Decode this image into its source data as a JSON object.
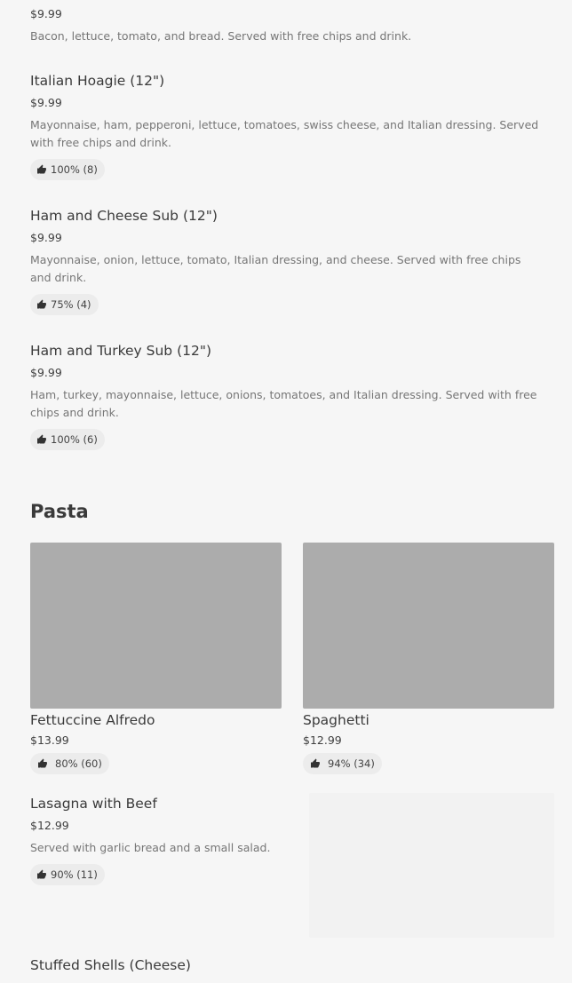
{
  "items_top": [
    {
      "price": "$9.99",
      "description": "Bacon, lettuce, tomato, and bread. Served with free chips and drink."
    },
    {
      "name": "Italian Hoagie (12\")",
      "price": "$9.99",
      "description": "Mayonnaise, ham, pepperoni, lettuce, tomatoes, swiss cheese, and Italian dressing. Served with free chips and drink.",
      "rating": "100% (8)"
    },
    {
      "name": "Ham and Cheese Sub (12\")",
      "price": "$9.99",
      "description": "Mayonnaise, onion, lettuce, tomato, Italian dressing, and cheese. Served with free chips and drink.",
      "rating": "75% (4)"
    },
    {
      "name": "Ham and Turkey Sub (12\")",
      "price": "$9.99",
      "description": "Ham, turkey, mayonnaise, lettuce, onions, tomatoes, and Italian dressing. Served with free chips and drink.",
      "rating": "100% (6)"
    }
  ],
  "pasta": {
    "section_title": "Pasta",
    "cards": [
      {
        "name": "Fettuccine Alfredo",
        "price": "$13.99",
        "rating": "80% (60)"
      },
      {
        "name": "Spaghetti",
        "price": "$12.99",
        "rating": "94% (34)"
      }
    ],
    "lasagna": {
      "name": "Lasagna with Beef",
      "price": "$12.99",
      "description": "Served with garlic bread and a small salad.",
      "rating": "90% (11)"
    },
    "stuffed_shells": {
      "name": "Stuffed Shells (Cheese)"
    }
  },
  "icons": {
    "rating": "thumbs-up-icon"
  },
  "colors": {
    "background": "#f6f6f6",
    "image_placeholder": "#acacac",
    "badge": "#ececec"
  }
}
